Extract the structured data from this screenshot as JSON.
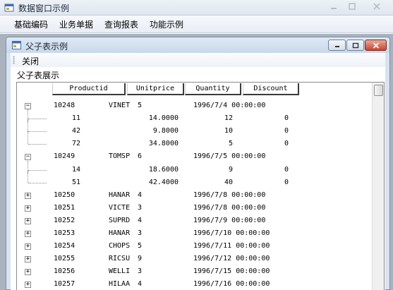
{
  "window": {
    "title": "数据窗口示例"
  },
  "menu": [
    {
      "label": "基础编码"
    },
    {
      "label": "业务单据"
    },
    {
      "label": "查询报表"
    },
    {
      "label": "功能示例"
    }
  ],
  "child_window": {
    "title": "父子表示例",
    "toolbar": {
      "close_label": "关闭"
    },
    "grid_label": "父子表展示"
  },
  "grid": {
    "columns": [
      {
        "label": "Productid"
      },
      {
        "label": "Unitprice"
      },
      {
        "label": "Quantity"
      },
      {
        "label": "Discount"
      }
    ],
    "rows": [
      {
        "kind": "parent",
        "expanded": true,
        "order": "10248",
        "customer": "VINET",
        "emp": "5",
        "date": "1996/7/4 00:00:00"
      },
      {
        "kind": "child",
        "productid": "11",
        "unitprice": "14.0000",
        "quantity": "12",
        "discount": "0"
      },
      {
        "kind": "child",
        "productid": "42",
        "unitprice": "9.8000",
        "quantity": "10",
        "discount": "0"
      },
      {
        "kind": "child",
        "productid": "72",
        "unitprice": "34.8000",
        "quantity": "5",
        "discount": "0",
        "last": true
      },
      {
        "kind": "parent",
        "expanded": true,
        "order": "10249",
        "customer": "TOMSP",
        "emp": "6",
        "date": "1996/7/5 00:00:00"
      },
      {
        "kind": "child",
        "productid": "14",
        "unitprice": "18.6000",
        "quantity": "9",
        "discount": "0"
      },
      {
        "kind": "child",
        "productid": "51",
        "unitprice": "42.4000",
        "quantity": "40",
        "discount": "0",
        "last": true
      },
      {
        "kind": "parent",
        "expanded": false,
        "order": "10250",
        "customer": "HANAR",
        "emp": "4",
        "date": "1996/7/8 00:00:00"
      },
      {
        "kind": "parent",
        "expanded": false,
        "order": "10251",
        "customer": "VICTE",
        "emp": "3",
        "date": "1996/7/8 00:00:00"
      },
      {
        "kind": "parent",
        "expanded": false,
        "order": "10252",
        "customer": "SUPRD",
        "emp": "4",
        "date": "1996/7/9 00:00:00"
      },
      {
        "kind": "parent",
        "expanded": false,
        "order": "10253",
        "customer": "HANAR",
        "emp": "3",
        "date": "1996/7/10 00:00:00"
      },
      {
        "kind": "parent",
        "expanded": false,
        "order": "10254",
        "customer": "CHOPS",
        "emp": "5",
        "date": "1996/7/11 00:00:00"
      },
      {
        "kind": "parent",
        "expanded": false,
        "order": "10255",
        "customer": "RICSU",
        "emp": "9",
        "date": "1996/7/12 00:00:00"
      },
      {
        "kind": "parent",
        "expanded": false,
        "order": "10256",
        "customer": "WELLI",
        "emp": "3",
        "date": "1996/7/15 00:00:00"
      },
      {
        "kind": "parent",
        "expanded": false,
        "order": "10257",
        "customer": "HILAA",
        "emp": "4",
        "date": "1996/7/16 00:00:00"
      }
    ]
  },
  "icons": {
    "app": "app-window-icon",
    "child": "form-icon",
    "minimize": "minimize-icon",
    "maximize": "maximize-icon",
    "close": "close-icon",
    "expand": "plus-box-icon",
    "collapse": "minus-box-icon"
  },
  "colors": {
    "close_button": "#c8452f",
    "mdi_background": "#aab3bd",
    "child_frame": "#d7e3f1"
  }
}
